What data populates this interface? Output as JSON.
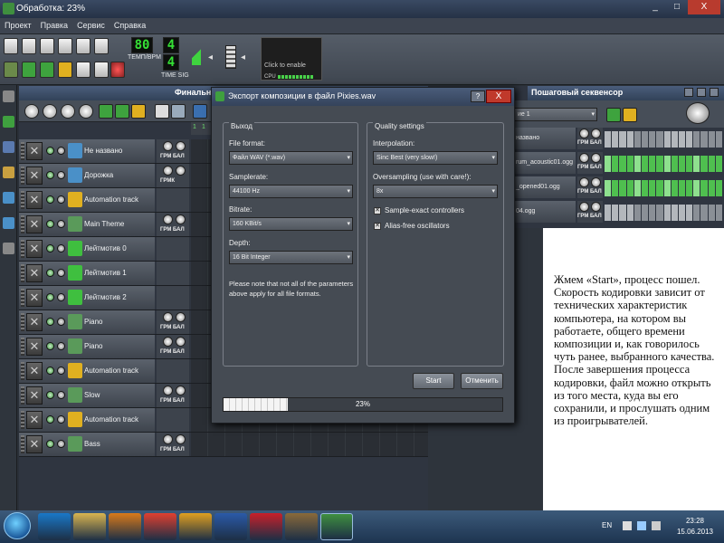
{
  "window": {
    "title": "Обработка: 23%",
    "buttons": [
      "_",
      "□",
      "X"
    ]
  },
  "menu": [
    "Проект",
    "Правка",
    "Сервис",
    "Справка"
  ],
  "toolbar": {
    "tempo_value": "80",
    "tempo_label": "ТЕМП/BPM",
    "timesig_num": "4",
    "timesig_den": "4",
    "timesig_label": "TIME SIG",
    "vis_text": "Click to enable",
    "cpu_label": "CPU"
  },
  "song_editor": {
    "title": "Финальн",
    "timeline_marks": [
      "1",
      "1"
    ],
    "tracks": [
      {
        "name": "Не названо",
        "knob_label": "ГРМ БАЛ",
        "icon": "instrument-icon",
        "color": "#4a90c8",
        "led_color": "#3c8a3c"
      },
      {
        "name": "Дорожка",
        "knob_label": "ГРМК",
        "icon": "instrument-icon",
        "color": "#4a90c8"
      },
      {
        "name": "Automation track",
        "knob_label": "",
        "icon": "folder-icon",
        "color": "#e0b020"
      },
      {
        "name": "Main Theme",
        "knob_label": "ГРМ БАЛ",
        "icon": "plugin-icon",
        "color": "#5a9a5a"
      },
      {
        "name": "Лейтмотив 0",
        "knob_label": "",
        "icon": "pattern-icon",
        "color": "#3fbf3f"
      },
      {
        "name": "Лейтмотив 1",
        "knob_label": "",
        "icon": "pattern-icon",
        "color": "#3fbf3f"
      },
      {
        "name": "Лейтмотив 2",
        "knob_label": "",
        "icon": "pattern-icon",
        "color": "#3fbf3f"
      },
      {
        "name": "Piano",
        "knob_label": "ГРМ БАЛ",
        "icon": "plugin-icon",
        "color": "#5a9a5a"
      },
      {
        "name": "Piano",
        "knob_label": "ГРМ БАЛ",
        "icon": "plugin-icon",
        "color": "#5a9a5a"
      },
      {
        "name": "Automation track",
        "knob_label": "",
        "icon": "folder-icon",
        "color": "#e0b020"
      },
      {
        "name": "Slow",
        "knob_label": "ГРМ БАЛ",
        "icon": "plugin-icon",
        "color": "#5a9a5a"
      },
      {
        "name": "Automation track",
        "knob_label": "",
        "icon": "folder-icon",
        "color": "#e0b020"
      },
      {
        "name": "Bass",
        "knob_label": "ГРМ БАЛ",
        "icon": "plugin-icon",
        "color": "#5a9a5a"
      }
    ]
  },
  "export_dialog": {
    "title": "Экспорт композиции в файл Pixies.wav",
    "help": "?",
    "close": "X",
    "output_group": "Выход",
    "file_format_label": "File format:",
    "file_format_value": "Файл WAV (*.wav)",
    "samplerate_label": "Samplerate:",
    "samplerate_value": "44100 Hz",
    "bitrate_label": "Bitrate:",
    "bitrate_value": "160 KBit/s",
    "depth_label": "Depth:",
    "depth_value": "16 Bit Integer",
    "note": "Please note that not all of the parameters above apply for all file formats.",
    "quality_group": "Quality settings",
    "interpolation_label": "Interpolation:",
    "interpolation_value": "Sinc Best (very slow!)",
    "oversampling_label": "Oversampling (use with care!):",
    "oversampling_value": "8x",
    "sample_exact_label": "Sample-exact controllers",
    "sample_exact_checked": true,
    "alias_free_label": "Alias-free oscillators",
    "alias_free_checked": true,
    "start_button": "Start",
    "cancel_button": "Отменить",
    "progress_percent": 23,
    "progress_text": "23%"
  },
  "step_sequencer": {
    "title": "Пошаговый секвенсор",
    "pattern_select": "ие 1",
    "rows": [
      {
        "name": "названо",
        "knob_label": "ГРМ БАЛ",
        "active_steps": 0
      },
      {
        "name": "rum_acoustic01.ogg",
        "knob_label": "ГРМ БАЛ",
        "active_steps": 16
      },
      {
        "name": "_opened01.ogg",
        "knob_label": "ГРМ БАЛ",
        "active_steps": 16
      },
      {
        "name": "04.ogg",
        "knob_label": "ГРМ БАЛ",
        "active_steps": 0
      }
    ]
  },
  "caption": "Жмем «Start», процесс пошел. Скорость кодировки зависит от технических характеристик компьютера, на котором вы работаете, общего времени композиции и, как говорилось чуть ранее, выбранного качества. После завершения процесса кодировки, файл можно открыть из того места, куда вы его сохранили, и прослушать одним из проигрывателей.",
  "taskbar": {
    "apps": [
      "ie-icon",
      "explorer-icon",
      "media-player-icon",
      "chrome-icon",
      "winamp-icon",
      "word-icon",
      "paint-icon",
      "film-icon",
      "lmms-icon"
    ],
    "lang": "EN",
    "time": "23:28",
    "date": "15.06.2013"
  }
}
